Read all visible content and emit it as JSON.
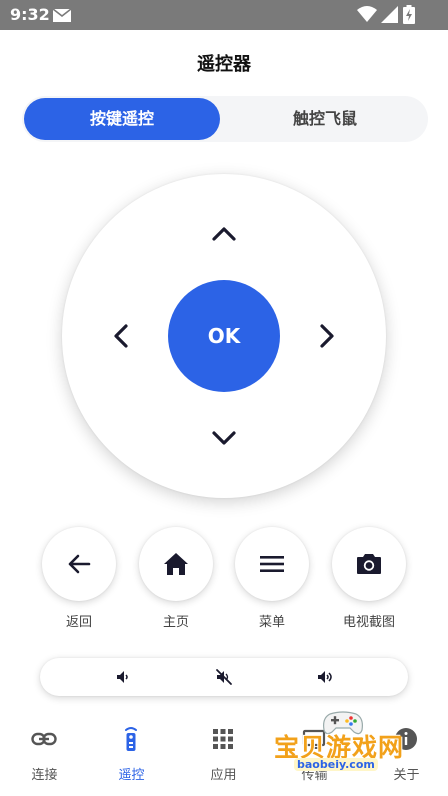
{
  "status_bar": {
    "time": "9:32",
    "bg_color": "#7a7a7a"
  },
  "page": {
    "title": "遥控器"
  },
  "mode_toggle": {
    "active_label": "按键遥控",
    "inactive_label": "触控飞鼠",
    "accent": "#2c63e6"
  },
  "dpad": {
    "ok_label": "OK"
  },
  "actions": [
    {
      "icon": "back-arrow-icon",
      "label": "返回"
    },
    {
      "icon": "home-icon",
      "label": "主页"
    },
    {
      "icon": "menu-icon",
      "label": "菜单"
    },
    {
      "icon": "camera-icon",
      "label": "电视截图"
    }
  ],
  "volume": {
    "buttons": [
      "volume-down-icon",
      "mute-icon",
      "volume-up-icon"
    ]
  },
  "bottom_nav": [
    {
      "icon": "link-icon",
      "label": "连接",
      "active": false
    },
    {
      "icon": "remote-icon",
      "label": "遥控",
      "active": true
    },
    {
      "icon": "grid-icon",
      "label": "应用",
      "active": false
    },
    {
      "icon": "transfer-icon",
      "label": "传输",
      "active": false
    },
    {
      "icon": "info-icon",
      "label": "关于",
      "active": false
    }
  ],
  "watermark": {
    "text": "宝贝游戏网",
    "url": "baobeiy.com"
  }
}
